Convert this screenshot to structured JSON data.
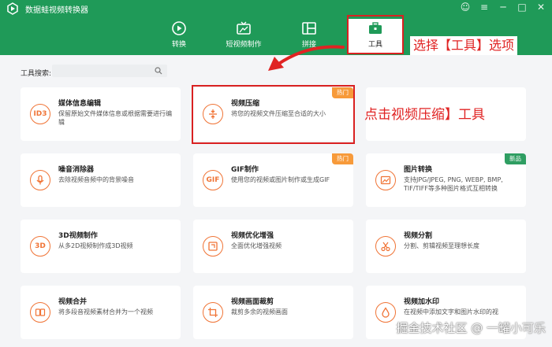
{
  "app": {
    "title": "数据蛙视频转换器",
    "win_controls": [
      "☺",
      "≡",
      "─",
      "□",
      "✕"
    ]
  },
  "tabs": [
    {
      "label": "转换",
      "icon": "convert-icon"
    },
    {
      "label": "短视频制作",
      "icon": "tv-icon"
    },
    {
      "label": "拼接",
      "icon": "layout-icon"
    },
    {
      "label": "工具",
      "icon": "toolbox-icon",
      "active": true
    }
  ],
  "annotations": {
    "select_tool": "选择【工具】选项",
    "click_compress": "点击视频压缩】工具"
  },
  "search": {
    "label": "工具搜索:",
    "value": ""
  },
  "cards": [
    {
      "title": "媒体信息编辑",
      "desc": "保留原始文件媒体信息或根据需要进行编辑",
      "icon": "id3-icon",
      "icon_text": "ID3"
    },
    {
      "title": "视频压缩",
      "desc": "将您的视频文件压缩至合适的大小",
      "icon": "compress-icon",
      "badge": "热门"
    },
    {
      "title": "",
      "desc": "",
      "icon": ""
    },
    {
      "title": "噪音消除器",
      "desc": "去除视频音频中的背景噪音",
      "icon": "noise-icon"
    },
    {
      "title": "GIF制作",
      "desc": "使用您的视频或图片制作或生成GIF",
      "icon": "gif-icon",
      "icon_text": "GIF",
      "badge": "热门"
    },
    {
      "title": "图片转换",
      "desc": "支持JPG/JPEG, PNG, WEBP, BMP, TIF/TIFF等多种图片格式互相转换",
      "icon": "image-convert-icon",
      "badge": "新品"
    },
    {
      "title": "3D视频制作",
      "desc": "从多2D视频制作成3D视频",
      "icon": "3d-icon",
      "icon_text": "3D"
    },
    {
      "title": "视频优化增强",
      "desc": "全面优化增强视频",
      "icon": "enhance-icon"
    },
    {
      "title": "视频分割",
      "desc": "分割、剪辑视频至理想长度",
      "icon": "scissors-icon"
    },
    {
      "title": "视频合并",
      "desc": "将多段音视频素材合并为一个视频",
      "icon": "merge-icon"
    },
    {
      "title": "视频画面裁剪",
      "desc": "裁剪多余的视频画面",
      "icon": "crop-icon"
    },
    {
      "title": "视频加水印",
      "desc": "在视频中添加文字和图片水印的视",
      "icon": "watermark-icon"
    }
  ],
  "watermark": "掘金技术社区 @ 一罐小可乐",
  "colors": {
    "brand_green": "#1f9a58",
    "accent_orange": "#f07436",
    "highlight_red": "#d92121"
  }
}
